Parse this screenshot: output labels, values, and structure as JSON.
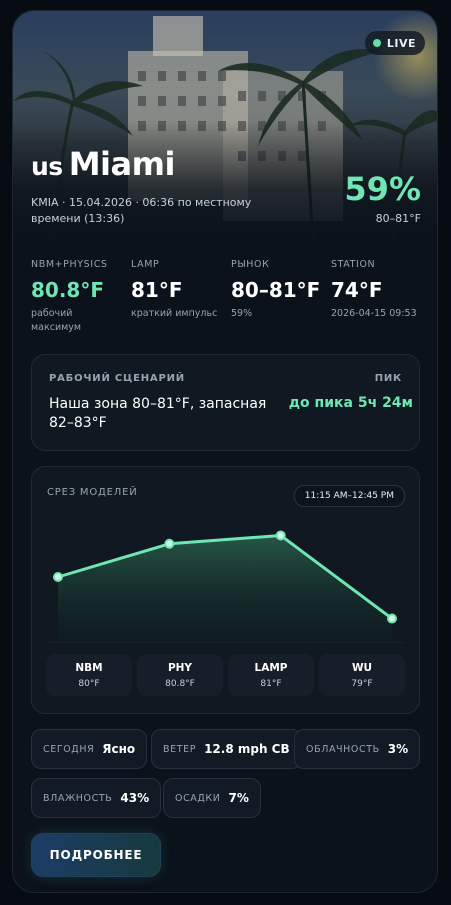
{
  "hero": {
    "live_label": "LIVE",
    "country_code": "us",
    "city": "Miami",
    "meta": "KMIA · 15.04.2026 · 06:36 по местному времени (13:36)",
    "probability": "59%",
    "range": "80–81°F"
  },
  "stats": [
    {
      "label": "NBM+PHYSICS",
      "value": "80.8°F",
      "note": "рабочий максимум"
    },
    {
      "label": "LAMP",
      "value": "81°F",
      "note": "краткий импульс"
    },
    {
      "label": "РЫНОК",
      "value": "80–81°F",
      "note": "59%"
    },
    {
      "label": "STATION",
      "value": "74°F",
      "note": "2026-04-15 09:53"
    }
  ],
  "scenario": {
    "label": "РАБОЧИЙ СЦЕНАРИЙ",
    "peak_label": "ПИК",
    "text": "Наша зона 80–81°F, запасная 82–83°F",
    "peak_value": "до пика 5ч 24м"
  },
  "models": {
    "label": "СРЕЗ МОДЕЛЕЙ",
    "time_range": "11:15 AM–12:45 PM",
    "cards": [
      {
        "name": "NBM",
        "value": "80°F"
      },
      {
        "name": "PHY",
        "value": "80.8°F"
      },
      {
        "name": "LAMP",
        "value": "81°F"
      },
      {
        "name": "WU",
        "value": "79°F"
      }
    ]
  },
  "chart_data": {
    "type": "area",
    "categories": [
      "NBM",
      "PHY",
      "LAMP",
      "WU"
    ],
    "values": [
      80,
      80.8,
      81,
      79
    ],
    "ylim": [
      78.7,
      81.3
    ],
    "line_color": "#6fe6b3"
  },
  "conditions": {
    "today_label": "СЕГОДНЯ",
    "today_value": "Ясно",
    "wind_label": "ВЕТЕР",
    "wind_value": "12.8 mph СВ",
    "cloud_label": "ОБЛАЧНОСТЬ",
    "cloud_value": "3%",
    "humidity_label": "ВЛАЖНОСТЬ",
    "humidity_value": "43%",
    "precip_label": "ОСАДКИ",
    "precip_value": "7%"
  },
  "more_button": "ПОДРОБНЕЕ",
  "colors": {
    "accent": "#6fe6b3",
    "background": "#0b121b"
  }
}
